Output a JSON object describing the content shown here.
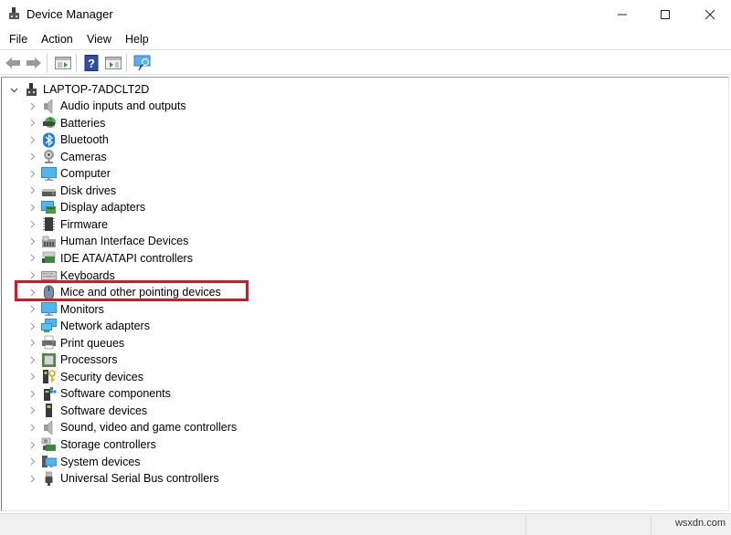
{
  "window": {
    "title": "Device Manager",
    "icon": "device-manager-icon",
    "controls": {
      "minimize": "minimize-icon",
      "maximize": "maximize-icon",
      "close": "close-icon"
    }
  },
  "menubar": {
    "items": [
      {
        "label": "File"
      },
      {
        "label": "Action"
      },
      {
        "label": "View"
      },
      {
        "label": "Help"
      }
    ]
  },
  "toolbar": {
    "buttons": [
      {
        "name": "back",
        "icon": "back-arrow-icon"
      },
      {
        "name": "forward",
        "icon": "forward-arrow-icon"
      },
      {
        "name": "show-hide-console-tree",
        "icon": "console-tree-icon"
      },
      {
        "name": "help",
        "icon": "help-icon"
      },
      {
        "name": "show-action-pane",
        "icon": "action-pane-icon"
      },
      {
        "name": "scan-hardware",
        "icon": "monitor-scan-icon"
      }
    ]
  },
  "tree": {
    "root": {
      "label": "LAPTOP-7ADCLT2D",
      "expanded": true,
      "icon": "computer-tower-icon"
    },
    "categories": [
      {
        "label": "Audio inputs and outputs",
        "icon": "speaker-icon"
      },
      {
        "label": "Batteries",
        "icon": "battery-icon"
      },
      {
        "label": "Bluetooth",
        "icon": "bluetooth-icon"
      },
      {
        "label": "Cameras",
        "icon": "camera-icon"
      },
      {
        "label": "Computer",
        "icon": "computer-icon"
      },
      {
        "label": "Disk drives",
        "icon": "disk-drive-icon"
      },
      {
        "label": "Display adapters",
        "icon": "display-adapter-icon"
      },
      {
        "label": "Firmware",
        "icon": "firmware-chip-icon"
      },
      {
        "label": "Human Interface Devices",
        "icon": "hid-icon"
      },
      {
        "label": "IDE ATA/ATAPI controllers",
        "icon": "ide-controller-icon"
      },
      {
        "label": "Keyboards",
        "icon": "keyboard-icon"
      },
      {
        "label": "Mice and other pointing devices",
        "icon": "mouse-icon",
        "highlighted": true
      },
      {
        "label": "Monitors",
        "icon": "monitor-icon"
      },
      {
        "label": "Network adapters",
        "icon": "network-adapter-icon"
      },
      {
        "label": "Print queues",
        "icon": "printer-icon"
      },
      {
        "label": "Processors",
        "icon": "processor-icon"
      },
      {
        "label": "Security devices",
        "icon": "security-key-icon"
      },
      {
        "label": "Software components",
        "icon": "software-component-icon"
      },
      {
        "label": "Software devices",
        "icon": "software-device-icon"
      },
      {
        "label": "Sound, video and game controllers",
        "icon": "speaker-icon"
      },
      {
        "label": "Storage controllers",
        "icon": "storage-controller-icon"
      },
      {
        "label": "System devices",
        "icon": "system-devices-icon"
      },
      {
        "label": "Universal Serial Bus controllers",
        "icon": "usb-icon"
      }
    ]
  },
  "colors": {
    "highlight_border": "#e0141e",
    "statusbar_bg": "#f0f0f0"
  },
  "statusbar": {
    "watermark": "wsxdn.com"
  }
}
